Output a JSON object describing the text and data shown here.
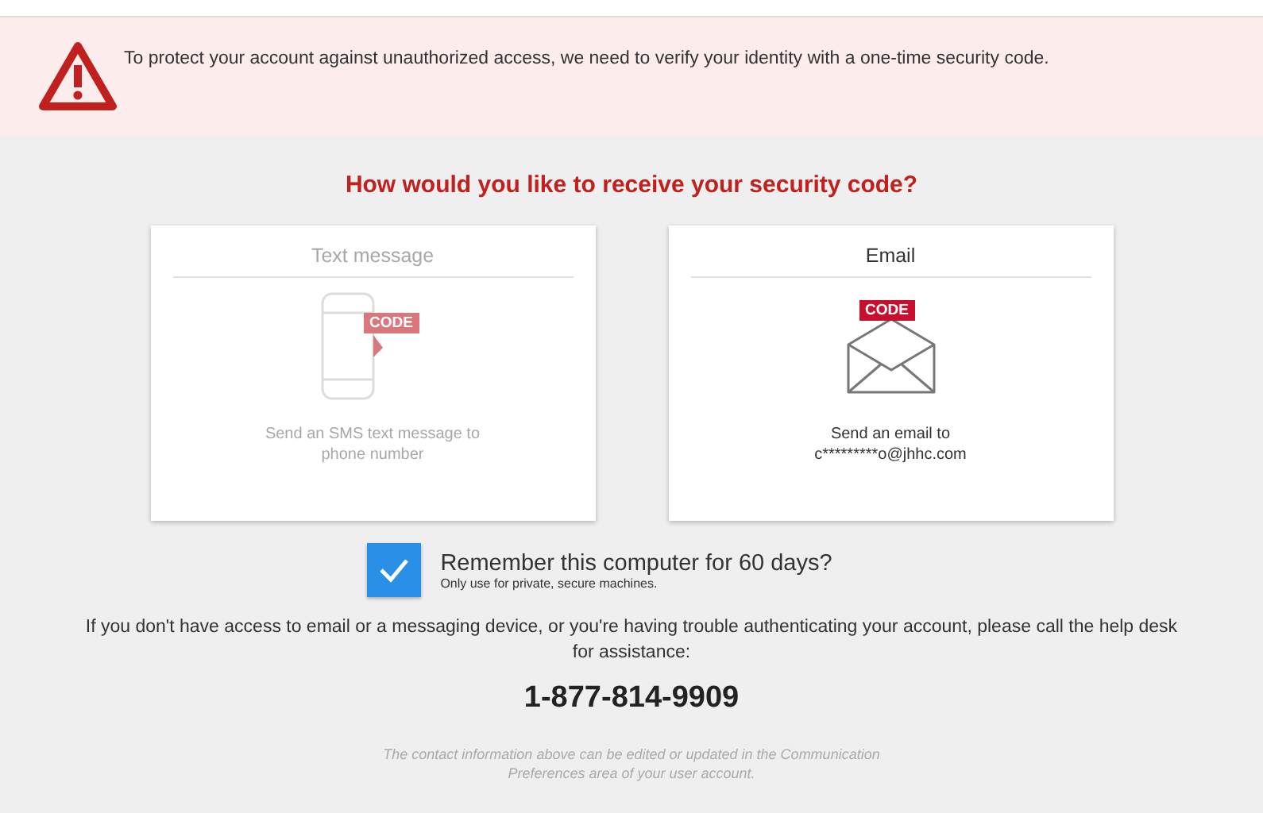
{
  "alert": {
    "message": "To protect your account against unauthorized access, we need to verify your identity with a one-time security code."
  },
  "heading": "How would you like to receive your security code?",
  "options": [
    {
      "kind": "sms",
      "title": "Text message",
      "badge": "CODE",
      "line1": "Send an SMS text message to",
      "line2": "phone number",
      "disabled": true
    },
    {
      "kind": "email",
      "title": "Email",
      "badge": "CODE",
      "line1": "Send an email to",
      "line2": "c*********o@jhhc.com",
      "disabled": false
    }
  ],
  "remember": {
    "label": "Remember this computer for 60 days?",
    "hint": "Only use for private, secure machines.",
    "checked": true
  },
  "help": "If you don't have access to email or a messaging device, or you're having trouble authenticating your account, please call the help desk for assistance:",
  "phone": "1-877-814-9909",
  "footnote": "The contact information above can be edited or updated in the Communication Preferences area of your user account."
}
